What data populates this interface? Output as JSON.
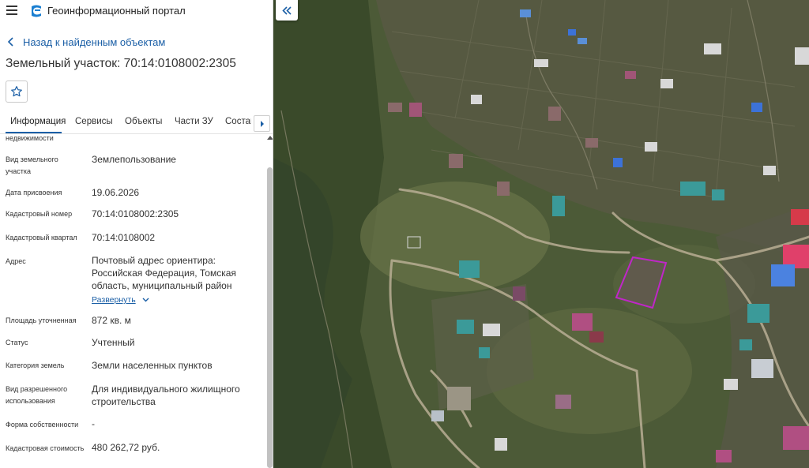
{
  "header": {
    "title": "Геоинформационный портал"
  },
  "back_link": {
    "label": "Назад к найденным объектам"
  },
  "object": {
    "title": "Земельный участок: 70:14:0108002:2305"
  },
  "tabs": [
    {
      "label": "Информация"
    },
    {
      "label": "Сервисы"
    },
    {
      "label": "Объекты"
    },
    {
      "label": "Части ЗУ"
    },
    {
      "label": "Состав"
    }
  ],
  "info": {
    "top_cut_label": "недвижимости",
    "rows": [
      {
        "label": "Вид земельного участка",
        "value": "Землепользование"
      },
      {
        "label": "Дата присвоения",
        "value": "19.06.2026"
      },
      {
        "label": "Кадастровый номер",
        "value": "70:14:0108002:2305"
      },
      {
        "label": "Кадастровый квартал",
        "value": "70:14:0108002"
      },
      {
        "label": "Адрес",
        "value": "Почтовый адрес ориентира: Российская Федерация, Томская область, муниципальный район"
      },
      {
        "label": "Площадь уточненная",
        "value": "872 кв. м"
      },
      {
        "label": "Статус",
        "value": "Учтенный"
      },
      {
        "label": "Категория земель",
        "value": "Земли населенных пунктов"
      },
      {
        "label": "Вид разрешенного использования",
        "value": "Для индивидуального жилищного строительства"
      },
      {
        "label": "Форма собственности",
        "value": "-"
      },
      {
        "label": "Кадастровая стоимость",
        "value": "480 262,72 руб."
      }
    ],
    "expand_label": "Развернуть"
  },
  "colors": {
    "accent": "#1b5fa6",
    "parcel_outline": "#c026c8",
    "map_vegetation": "#4f5d3b"
  }
}
